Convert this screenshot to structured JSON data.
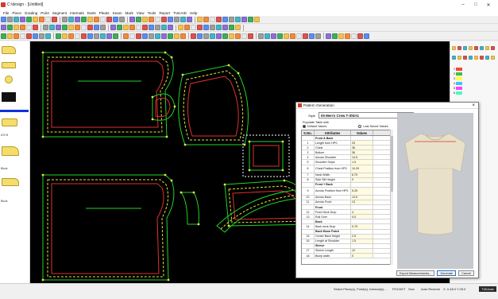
{
  "window": {
    "title": "C:\\design - [Untitled]"
  },
  "menu": [
    "File",
    "Piece",
    "Grading",
    "Point",
    "Segment",
    "Internals",
    "Darts",
    "Pleats",
    "Seam",
    "Mark",
    "View",
    "Tools",
    "Report",
    "TUKAID",
    "Help"
  ],
  "pieces_panel": {
    "labels": [
      "ATCH",
      "Block",
      "Block"
    ]
  },
  "dialog": {
    "title": "Pattern Generation",
    "style_label": "Style",
    "style_value": "00 Men's Crew T-Shirt1",
    "populate_label": "Populate Table with",
    "radio_default": "Default Values",
    "radio_last": "Last Saved Values",
    "columns": [
      "S.No.",
      "Attributes",
      "Values"
    ],
    "rows": [
      {
        "no": "",
        "attr": "Front & Back",
        "val": "",
        "section": true
      },
      {
        "no": "1",
        "attr": "Length from HPS",
        "val": "25"
      },
      {
        "no": "2",
        "attr": "Chest",
        "val": "36"
      },
      {
        "no": "3",
        "attr": "Bottom",
        "val": "36"
      },
      {
        "no": "4",
        "attr": "Across Shoulder",
        "val": "14.5"
      },
      {
        "no": "5",
        "attr": "Shoulder Slope",
        "val": "1.5"
      },
      {
        "no": "6",
        "attr": "Chest Position from HPS",
        "val": "10.25"
      },
      {
        "no": "7",
        "attr": "Neck Width",
        "val": "6.75"
      },
      {
        "no": "8",
        "attr": "Side Slit Height",
        "val": "0"
      },
      {
        "no": "",
        "attr": "Front + Back",
        "val": "",
        "section": true
      },
      {
        "no": "9",
        "attr": "Across Position from HPS",
        "val": "5.25"
      },
      {
        "no": "10",
        "attr": "Across Back",
        "val": "13.5"
      },
      {
        "no": "11",
        "attr": "Across Front",
        "val": "13"
      },
      {
        "no": "",
        "attr": "Front",
        "val": "",
        "section": true
      },
      {
        "no": "12",
        "attr": "Front Neck Drop",
        "val": "4"
      },
      {
        "no": "13",
        "attr": "Roll Over",
        "val": "0.5"
      },
      {
        "no": "",
        "attr": "Back",
        "val": "",
        "section": true
      },
      {
        "no": "14",
        "attr": "Back neck Drop",
        "val": "0.75"
      },
      {
        "no": "",
        "attr": "Back Moon Patch",
        "val": "",
        "section": true
      },
      {
        "no": "15",
        "attr": "Center Back Height",
        "val": "2.5"
      },
      {
        "no": "16",
        "attr": "Length at Shoulder",
        "val": "1.5"
      },
      {
        "no": "",
        "attr": "Sleeve",
        "val": "",
        "section": true
      },
      {
        "no": "17",
        "attr": "Sleeve Length",
        "val": "12"
      },
      {
        "no": "18",
        "attr": "Bicep width",
        "val": "0"
      }
    ],
    "buttons": {
      "export": "Export Measurements...",
      "generate": "Generate",
      "cancel": "Cancel"
    }
  },
  "right_panel": {
    "rows": [
      {
        "label": "1",
        "color": "#ff4040"
      },
      {
        "label": "2",
        "color": "#40c040"
      },
      {
        "label": "3",
        "color": "#ffff40"
      },
      {
        "label": "4",
        "color": "#40c0ff"
      },
      {
        "label": "5",
        "color": "#ff40ff"
      },
      {
        "label": "6",
        "color": "#40ffc0"
      }
    ]
  },
  "statusbar": {
    "hint": "Select Piece(s), Point(s), Internal(s)...",
    "mode1": "POCKET",
    "mode2": "Sew",
    "mode3": "Auto Reserve",
    "coords": "X: 0.48.0  Y:25.0",
    "badge": "TUKAcad"
  },
  "colors": {
    "canvas": "#000000",
    "piece_outline": "#23d12a",
    "grading_line": "#e6e63a",
    "seam_red": "#e03030",
    "piece_fill_thumb": "#f4dd6a"
  }
}
